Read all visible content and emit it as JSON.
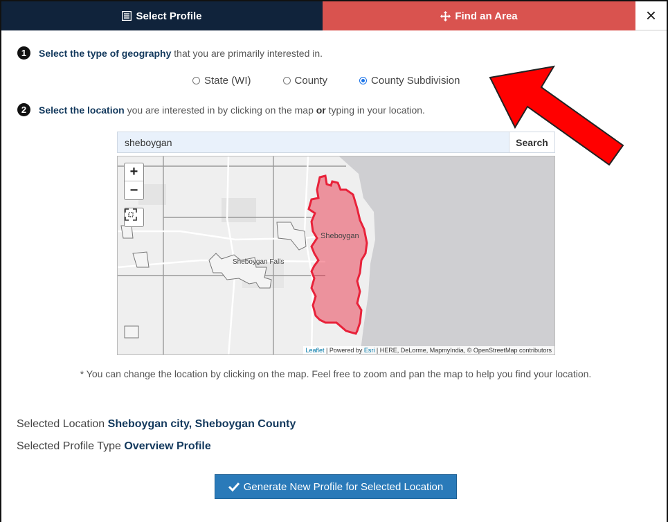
{
  "tabs": {
    "profile_label": "Select Profile",
    "area_label": "Find an Area",
    "close_label": "×"
  },
  "step1": {
    "number": "1",
    "bold": "Select the type of geography",
    "rest": "that you are primarily interested in."
  },
  "geography_options": {
    "state": "State (WI)",
    "county": "County",
    "subdivision": "County Subdivision",
    "selected": "County Subdivision"
  },
  "step2": {
    "number": "2",
    "bold": "Select the location",
    "rest1": "you are interested in by clicking on the map",
    "or": "or",
    "rest2": "typing in your location."
  },
  "search": {
    "value": "sheboygan",
    "button_label": "Search"
  },
  "map": {
    "zoom_in": "+",
    "zoom_out": "−",
    "label_sheboygan": "Sheboygan",
    "label_falls": "Sheboygan Falls",
    "attribution_leaflet": "Leaflet",
    "attribution_sep1": " | Powered by ",
    "attribution_esri": "Esri",
    "attribution_rest": " | HERE, DeLorme, MapmyIndia, © OpenStreetMap contributors",
    "highlight_color": "#e8223a"
  },
  "note": "* You can change the location by clicking on the map. Feel free to zoom and pan the map to help you find your location.",
  "selected_location": {
    "label": "Selected Location",
    "value": "Sheboygan city, Sheboygan County"
  },
  "selected_profile": {
    "label": "Selected Profile Type",
    "value": "Overview Profile"
  },
  "generate_button": "Generate New Profile for Selected Location",
  "colors": {
    "tab_dark": "#10233b",
    "tab_red": "#d9534f",
    "button_blue": "#2a7ab9",
    "arrow_red": "#ff0000"
  }
}
